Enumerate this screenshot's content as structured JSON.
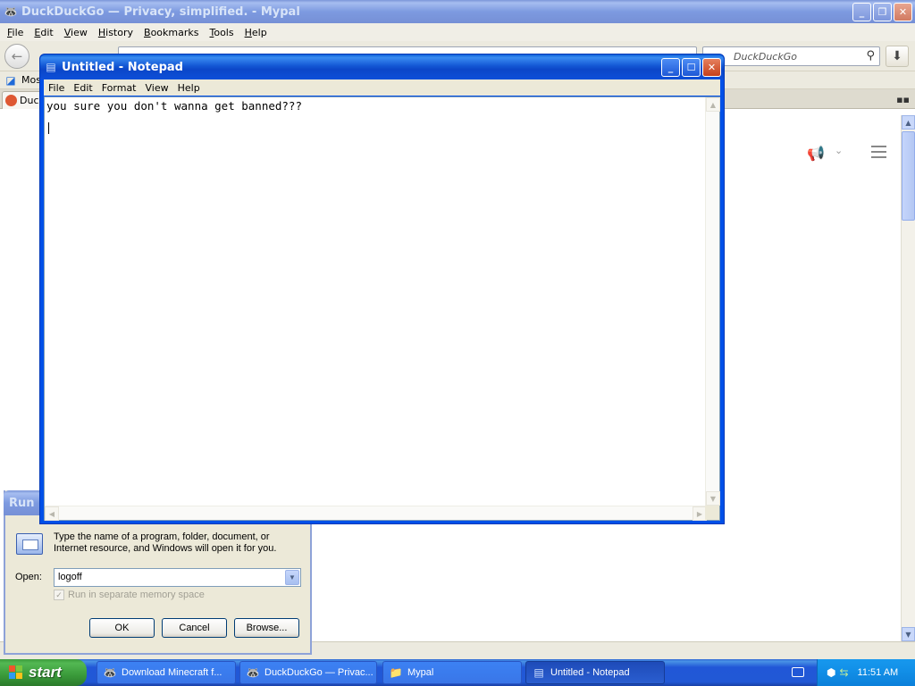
{
  "browser": {
    "title": "DuckDuckGo — Privacy, simplified. - Mypal",
    "menu": [
      "File",
      "Edit",
      "View",
      "History",
      "Bookmarks",
      "Tools",
      "Help"
    ],
    "search_placeholder": "DuckDuckGo",
    "bookmark_label": "Most",
    "tab_label": "Duck"
  },
  "notepad": {
    "title": "Untitled - Notepad",
    "menu": [
      "File",
      "Edit",
      "Format",
      "View",
      "Help"
    ],
    "text": "you sure you don't wanna get banned???"
  },
  "run": {
    "title": "Run",
    "description": "Type the name of a program, folder, document, or Internet resource, and Windows will open it for you.",
    "open_label": "Open:",
    "open_value": "logoff",
    "checkbox_label": "Run in separate memory space",
    "ok_label": "OK",
    "cancel_label": "Cancel",
    "browse_label": "Browse..."
  },
  "taskbar": {
    "start_label": "start",
    "tasks": [
      "Download Minecraft f...",
      "DuckDuckGo — Privac...",
      "Mypal",
      "Untitled - Notepad"
    ],
    "clock": "11:51 AM"
  }
}
